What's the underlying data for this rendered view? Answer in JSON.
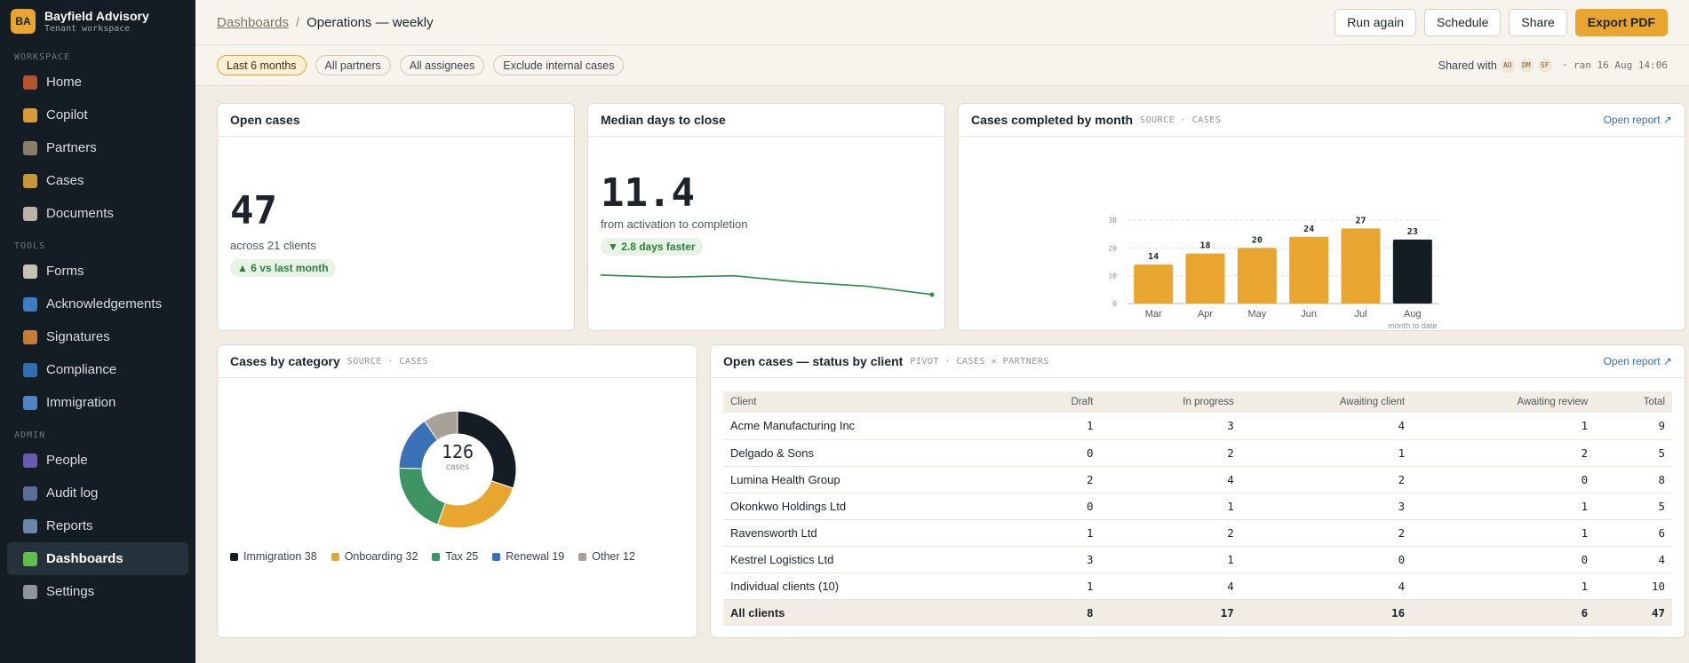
{
  "brand": {
    "initials": "BA",
    "name": "Bayfield Advisory",
    "subtitle": "Tenant workspace"
  },
  "sidebar": {
    "sections": [
      {
        "label": "WORKSPACE",
        "items": [
          {
            "label": "Home",
            "icon": "home-icon",
            "color": "#b5532f"
          },
          {
            "label": "Copilot",
            "icon": "sparkle-icon",
            "color": "#d89a3a"
          },
          {
            "label": "Partners",
            "icon": "clipboard-icon",
            "color": "#8a7d6c"
          },
          {
            "label": "Cases",
            "icon": "folder-icon",
            "color": "#c9963a"
          },
          {
            "label": "Documents",
            "icon": "document-icon",
            "color": "#b9b3a8"
          }
        ]
      },
      {
        "label": "TOOLS",
        "items": [
          {
            "label": "Forms",
            "icon": "form-icon",
            "color": "#c8c1b5"
          },
          {
            "label": "Acknowledgements",
            "icon": "pen-icon",
            "color": "#3f7cc4"
          },
          {
            "label": "Signatures",
            "icon": "signature-icon",
            "color": "#c47e3a"
          },
          {
            "label": "Compliance",
            "icon": "shield-icon",
            "color": "#2f6fb0"
          },
          {
            "label": "Immigration",
            "icon": "passport-icon",
            "color": "#4d86c2"
          }
        ]
      },
      {
        "label": "ADMIN",
        "items": [
          {
            "label": "People",
            "icon": "people-icon",
            "color": "#6a5bb0"
          },
          {
            "label": "Audit log",
            "icon": "audit-icon",
            "color": "#5b6e9c"
          },
          {
            "label": "Reports",
            "icon": "chart-icon",
            "color": "#6b86a8"
          },
          {
            "label": "Dashboards",
            "icon": "dashboard-icon",
            "color": "#5fbf4a",
            "active": true
          },
          {
            "label": "Settings",
            "icon": "gear-icon",
            "color": "#8d959b"
          }
        ]
      }
    ]
  },
  "header": {
    "breadcrumb_link": "Dashboards",
    "breadcrumb_sep": "/",
    "title": "Operations — weekly",
    "actions": {
      "run_again": "Run again",
      "schedule": "Schedule",
      "share": "Share",
      "export": "Export PDF"
    }
  },
  "filters": {
    "chips": [
      "Last 6 months",
      "All partners",
      "All assignees",
      "Exclude internal cases"
    ],
    "shared_label": "Shared with",
    "avatars": [
      "AO",
      "DM",
      "SF"
    ],
    "ran": "· ran 16 Aug 14:06"
  },
  "open_cases": {
    "title": "Open cases",
    "value": "47",
    "sub": "across 21 clients",
    "delta": "▲ 6 vs last month"
  },
  "median_days": {
    "title": "Median days to close",
    "value": "11.4",
    "sub": "from activation to completion",
    "delta": "▼ 2.8 days faster"
  },
  "completed_card": {
    "title": "Cases completed by month",
    "tag": "SOURCE · CASES",
    "link": "Open report ↗"
  },
  "category_card": {
    "title": "Cases by category",
    "tag": "SOURCE · CASES",
    "center_value": "126",
    "center_label": "cases"
  },
  "status_card": {
    "title": "Open cases — status by client",
    "tag": "PIVOT · CASES × PARTNERS",
    "link": "Open report ↗",
    "columns": [
      "Client",
      "Draft",
      "In progress",
      "Awaiting client",
      "Awaiting review",
      "Total"
    ],
    "rows": [
      [
        "Acme Manufacturing Inc",
        "1",
        "3",
        "4",
        "1",
        "9"
      ],
      [
        "Delgado & Sons",
        "0",
        "2",
        "1",
        "2",
        "5"
      ],
      [
        "Lumina Health Group",
        "2",
        "4",
        "2",
        "0",
        "8"
      ],
      [
        "Okonkwo Holdings Ltd",
        "0",
        "1",
        "3",
        "1",
        "5"
      ],
      [
        "Ravensworth Ltd",
        "1",
        "2",
        "2",
        "1",
        "6"
      ],
      [
        "Kestrel Logistics Ltd",
        "3",
        "1",
        "0",
        "0",
        "4"
      ],
      [
        "Individual clients (10)",
        "1",
        "4",
        "4",
        "1",
        "10"
      ]
    ],
    "total_row": [
      "All clients",
      "8",
      "17",
      "16",
      "6",
      "47"
    ]
  },
  "chart_data": [
    {
      "type": "bar",
      "categories": [
        "Mar",
        "Apr",
        "May",
        "Jun",
        "Jul",
        "Aug"
      ],
      "values": [
        14,
        18,
        20,
        24,
        27,
        23
      ],
      "category_note": {
        "Aug": "month to date"
      },
      "yticks": [
        0,
        10,
        20,
        30
      ],
      "ylim": [
        0,
        30
      ],
      "colors": {
        "default": "#e8a631",
        "highlight": "#141d24"
      },
      "highlight_index": 5
    },
    {
      "type": "pie",
      "donut": true,
      "labels": [
        "Immigration",
        "Onboarding",
        "Tax",
        "Renewal",
        "Other"
      ],
      "values": [
        38,
        32,
        25,
        19,
        12
      ],
      "colors": [
        "#141d24",
        "#e8a631",
        "#3f9463",
        "#3a70b5",
        "#a8a196"
      ]
    },
    {
      "type": "line",
      "description": "median days trend sparkline",
      "values": [
        14.2,
        13.9,
        14.1,
        13.2,
        12.6,
        11.4
      ],
      "color": "#2e8a49"
    }
  ]
}
